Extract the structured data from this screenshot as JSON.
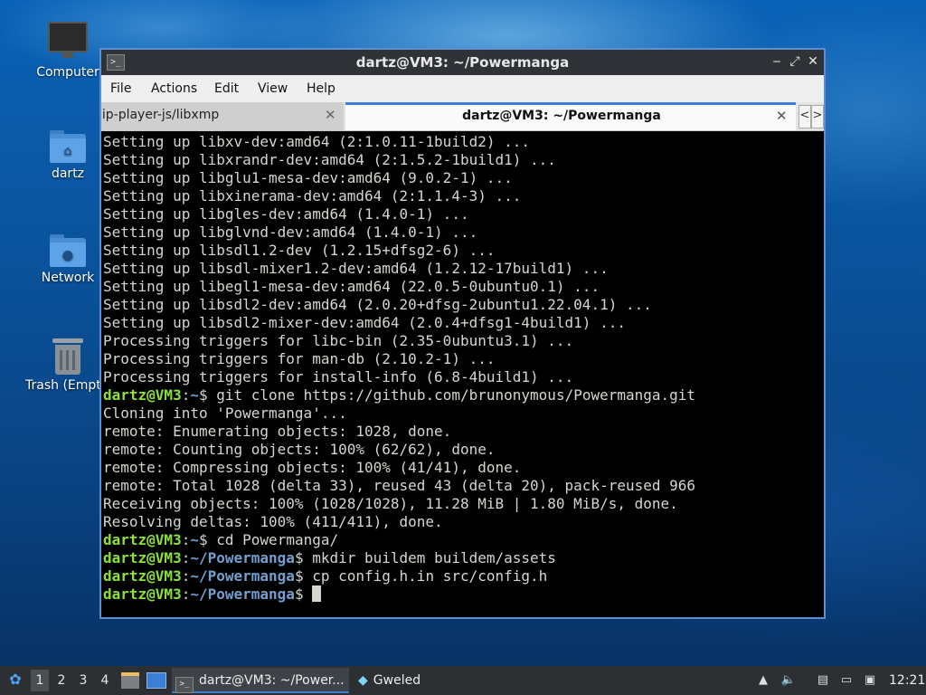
{
  "desktop": {
    "icons": [
      {
        "label": "Computer"
      },
      {
        "label": "dartz"
      },
      {
        "label": "Network"
      },
      {
        "label": "Trash (Empty)"
      }
    ]
  },
  "window": {
    "title": "dartz@VM3: ~/Powermanga",
    "controls": {
      "minimize": "‒",
      "maximize": "⤢",
      "close": "✕"
    }
  },
  "menubar": [
    "File",
    "Actions",
    "Edit",
    "View",
    "Help"
  ],
  "tabs": [
    {
      "label": "nip-player-js/libxmp",
      "active": false
    },
    {
      "label": "dartz@VM3: ~/Powermanga",
      "active": true
    }
  ],
  "tab_close": "✕",
  "tab_scroll": {
    "left": "<",
    "right": ">"
  },
  "terminal": {
    "lines": [
      "Setting up libxv-dev:amd64 (2:1.0.11-1build2) ...",
      "Setting up libxrandr-dev:amd64 (2:1.5.2-1build1) ...",
      "Setting up libglu1-mesa-dev:amd64 (9.0.2-1) ...",
      "Setting up libxinerama-dev:amd64 (2:1.1.4-3) ...",
      "Setting up libgles-dev:amd64 (1.4.0-1) ...",
      "Setting up libglvnd-dev:amd64 (1.4.0-1) ...",
      "Setting up libsdl1.2-dev (1.2.15+dfsg2-6) ...",
      "Setting up libsdl-mixer1.2-dev:amd64 (1.2.12-17build1) ...",
      "Setting up libegl1-mesa-dev:amd64 (22.0.5-0ubuntu0.1) ...",
      "Setting up libsdl2-dev:amd64 (2.0.20+dfsg-2ubuntu1.22.04.1) ...",
      "Setting up libsdl2-mixer-dev:amd64 (2.0.4+dfsg1-4build1) ...",
      "Processing triggers for libc-bin (2.35-0ubuntu3.1) ...",
      "Processing triggers for man-db (2.10.2-1) ...",
      "Processing triggers for install-info (6.8-4build1) ..."
    ],
    "prompt_user": "dartz@VM3",
    "commands": [
      {
        "path": "~",
        "cmd": " git clone https://github.com/brunonymous/Powermanga.git"
      },
      {
        "path": "~",
        "cmd": " cd Powermanga/"
      },
      {
        "path": "~/Powermanga",
        "cmd": " mkdir buildem buildem/assets"
      },
      {
        "path": "~/Powermanga",
        "cmd": " cp config.h.in src/config.h"
      },
      {
        "path": "~/Powermanga",
        "cmd": " "
      }
    ],
    "clone_output": [
      "Cloning into 'Powermanga'...",
      "remote: Enumerating objects: 1028, done.",
      "remote: Counting objects: 100% (62/62), done.",
      "remote: Compressing objects: 100% (41/41), done.",
      "remote: Total 1028 (delta 33), reused 43 (delta 20), pack-reused 966",
      "Receiving objects: 100% (1028/1028), 11.28 MiB | 1.80 MiB/s, done.",
      "Resolving deltas: 100% (411/411), done."
    ],
    "colors": {
      "prompt_user": "#8ae234",
      "prompt_path": "#729fcf",
      "text": "#d3d7cf",
      "background": "#000000"
    }
  },
  "taskbar": {
    "workspaces": [
      "1",
      "2",
      "3",
      "4"
    ],
    "active_workspace": "1",
    "tasks": [
      {
        "label": "dartz@VM3: ~/Power...",
        "icon": "terminal-icon",
        "active": true
      },
      {
        "label": "Gweled",
        "icon": "gem-icon",
        "active": false
      }
    ],
    "clock": "12:21"
  }
}
